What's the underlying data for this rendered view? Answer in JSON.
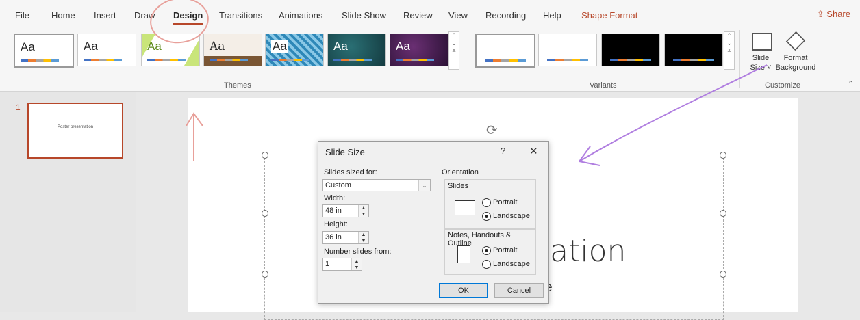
{
  "ribbon": {
    "tabs": [
      "File",
      "Home",
      "Insert",
      "Draw",
      "Design",
      "Transitions",
      "Animations",
      "Slide Show",
      "Review",
      "View",
      "Recording",
      "Help",
      "Shape Format"
    ],
    "active_tab": "Design",
    "share_label": "Share",
    "themes_group_label": "Themes",
    "variants_group_label": "Variants",
    "customize_group_label": "Customize",
    "theme_preview_text": "Aa",
    "slide_size_label": "Slide",
    "slide_size_label2": "Size",
    "format_background_label": "Format",
    "format_background_label2": "Background"
  },
  "thumbnail": {
    "number": "1",
    "text": "Poster presentation"
  },
  "slide": {
    "title_fragment": "ntation",
    "subtitle_fragment": "e"
  },
  "dialog": {
    "title": "Slide Size",
    "help": "?",
    "close": "✕",
    "slides_sized_for_label": "Slides sized for:",
    "slides_sized_for_value": "Custom",
    "width_label": "Width:",
    "width_value": "48 in",
    "height_label": "Height:",
    "height_value": "36 in",
    "number_from_label": "Number slides from:",
    "number_from_value": "1",
    "orientation_label": "Orientation",
    "slides_label": "Slides",
    "portrait_label": "Portrait",
    "landscape_label": "Landscape",
    "notes_label": "Notes, Handouts & Outline",
    "notes_portrait_label": "Portrait",
    "notes_landscape_label": "Landscape",
    "ok_label": "OK",
    "cancel_label": "Cancel",
    "slides_orientation": "Landscape",
    "notes_orientation": "Portrait"
  },
  "colors": {
    "accent": "#b7472a",
    "annotation_red": "#e8a09a",
    "annotation_purple": "#b07ee0"
  }
}
